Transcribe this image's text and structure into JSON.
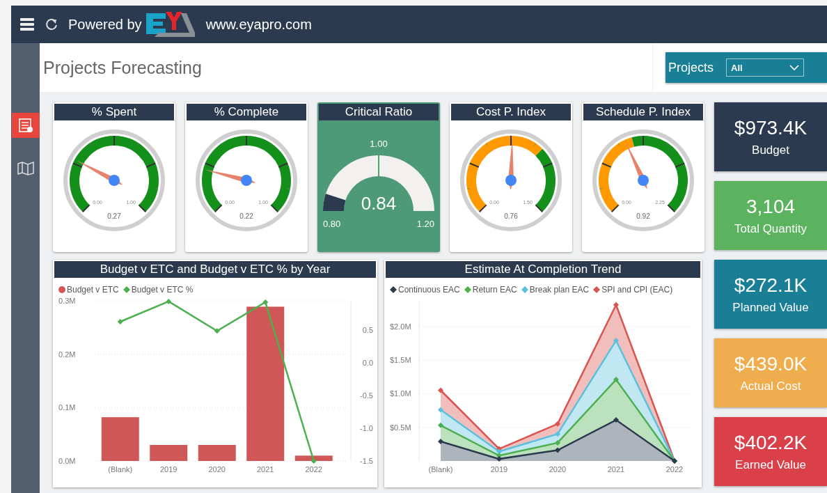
{
  "top_bar": {
    "powered_by": "Powered by",
    "url": "www.eyapro.com"
  },
  "sidebar": {
    "items": [
      {
        "kind": "report",
        "selected": true
      },
      {
        "kind": "map",
        "selected": false
      }
    ]
  },
  "page_title": "Projects Forecasting",
  "filter": {
    "label": "Projects",
    "value": "All"
  },
  "gauges": [
    {
      "title": "% Spent",
      "kind": "percent",
      "min": "0.00",
      "max": "1.00",
      "value": "0.27"
    },
    {
      "title": "% Complete",
      "kind": "percent",
      "min": "0.00",
      "max": "1.00",
      "value": "0.22"
    },
    {
      "title": "Critical Ratio",
      "kind": "half",
      "min": "0.80",
      "max": "1.20",
      "value": "0.84",
      "target": "1.00"
    },
    {
      "title": "Cost P. Index",
      "kind": "index",
      "min": "0.00",
      "max": "1.50",
      "value": "0.76"
    },
    {
      "title": "Schedule P. Index",
      "kind": "index",
      "min": "0.00",
      "max": "2.25",
      "value": "0.92"
    }
  ],
  "kpis": [
    {
      "value": "$973.4K",
      "label": "Budget",
      "color": "#2b3a4e"
    },
    {
      "value": "3,104",
      "label": "Total Quantity",
      "color": "#5cb35f"
    },
    {
      "value": "$272.1K",
      "label": "Planned Value",
      "color": "#1a7f96"
    },
    {
      "value": "$439.0K",
      "label": "Actual Cost",
      "color": "#f0ad4e"
    },
    {
      "value": "$402.2K",
      "label": "Earned Value",
      "color": "#d9404a"
    }
  ],
  "charts": [
    {
      "title": "Budget v ETC and Budget v ETC % by Year",
      "chart_data": {
        "type": "bar",
        "categories": [
          "(Blank)",
          "2019",
          "2020",
          "2021",
          "2022"
        ],
        "series": [
          {
            "name": "Budget v ETC",
            "color": "#d05757",
            "values": [
              0.082,
              0.03,
              0.03,
              0.289,
              0.01
            ]
          }
        ],
        "ylim": [
          0,
          0.3
        ],
        "grid": true,
        "legend": "top",
        "yticks": [
          {
            "value": 0,
            "label": "0.0M"
          },
          {
            "value": 0.1,
            "label": "0.1M"
          },
          {
            "value": 0.2,
            "label": "0.2M"
          },
          {
            "value": 0.3,
            "label": "0.3M"
          }
        ]
      },
      "overlay": {
        "chart_data": {
          "type": "line",
          "ylim": [
            -1.5,
            0.95
          ],
          "legend": "top",
          "series": [
            {
              "name": "Budget v ETC %",
              "color": "#4caf50",
              "marker": "diamond",
              "values": [
                0.63,
                0.94,
                0.49,
                0.93,
                -1.5
              ]
            }
          ],
          "yticks": [
            {
              "value": 0.5,
              "label": "0.5"
            },
            {
              "value": 0,
              "label": "0.0"
            },
            {
              "value": -0.5,
              "label": "-0.5"
            },
            {
              "value": -1,
              "label": "-1.0"
            },
            {
              "value": -1.5,
              "label": "-1.5"
            }
          ]
        }
      }
    },
    {
      "title": "Estimate At Completion Trend",
      "chart_data": {
        "type": "area",
        "categories": [
          "(Blank)",
          "2019",
          "2020",
          "2021",
          "2022"
        ],
        "series": [
          {
            "name": "Continuous EAC",
            "color": "#2b3a4e",
            "marker": "diamond",
            "values": [
              0.29,
              0.03,
              0.16,
              0.61,
              0
            ]
          },
          {
            "name": "Return EAC",
            "color": "#4caf50",
            "marker": "diamond",
            "values": [
              0.53,
              0.08,
              0.27,
              1.21,
              0
            ]
          },
          {
            "name": "Break plan EAC",
            "color": "#5bc0de",
            "marker": "diamond",
            "values": [
              0.76,
              0.14,
              0.4,
              1.79,
              0
            ]
          },
          {
            "name": "SPI and CPI (EAC)",
            "color": "#d9534f",
            "marker": "diamond",
            "values": [
              1.05,
              0.18,
              0.55,
              2.32,
              0
            ]
          }
        ],
        "ylim": [
          0,
          2.38
        ],
        "grid": true,
        "legend": "top",
        "yticks": [
          {
            "value": 0.5,
            "label": "$0.5M"
          },
          {
            "value": 1,
            "label": "$1.0M"
          },
          {
            "value": 1.5,
            "label": "$1.5M"
          },
          {
            "value": 2,
            "label": "$2.0M"
          }
        ]
      }
    }
  ]
}
